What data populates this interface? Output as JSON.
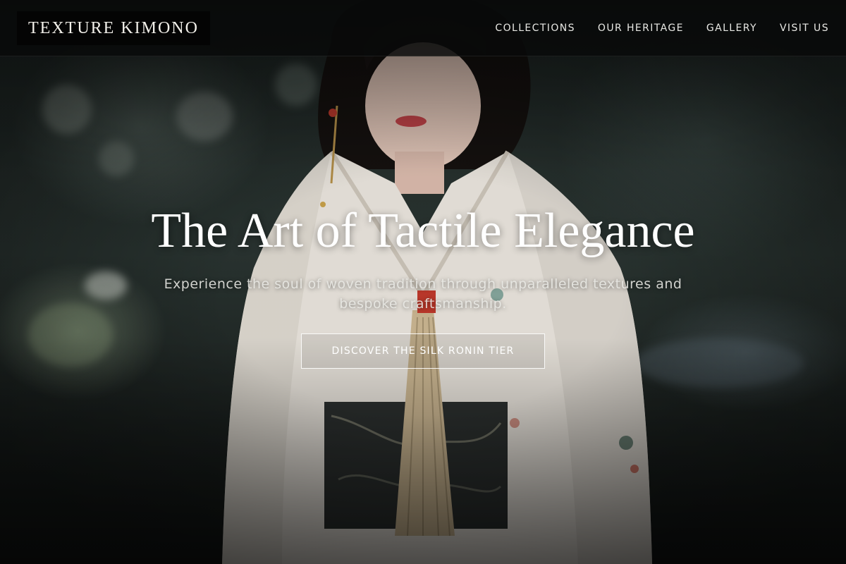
{
  "brand": {
    "logo_text": "TEXTURE KIMONO"
  },
  "nav": {
    "items": [
      {
        "label": "COLLECTIONS"
      },
      {
        "label": "OUR HERITAGE"
      },
      {
        "label": "GALLERY"
      },
      {
        "label": "VISIT US"
      }
    ]
  },
  "hero": {
    "title": "The Art of Tactile Elegance",
    "subtitle": "Experience the soul of woven tradition through unparalleled textures and bespoke craftsmanship.",
    "cta_label": "DISCOVER THE SILK RONIN TIER",
    "background_image": "woman-in-kimono-photo"
  },
  "colors": {
    "nav_background": "#0a0c0c",
    "text_primary": "#ffffff",
    "kimono": "#ece7df"
  }
}
